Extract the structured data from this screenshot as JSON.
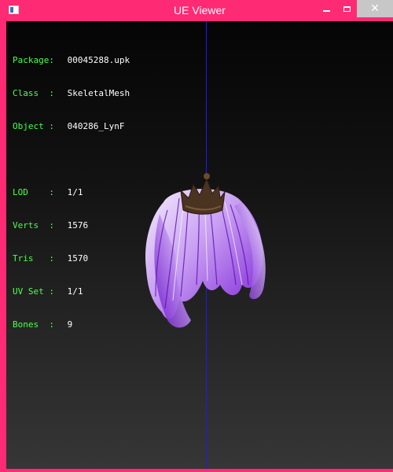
{
  "window": {
    "title": "UE Viewer",
    "close_glyph": "✕",
    "colors": {
      "frame": "#ff2a74",
      "close_button": "#c7c7c7",
      "label_text": "#4cff4c",
      "value_text": "#ffffff",
      "axis_line": "#1a1aff"
    }
  },
  "info": {
    "rows_top": [
      {
        "label": "Package:",
        "value": "00045288.upk"
      },
      {
        "label": "Class  :",
        "value": "SkeletalMesh"
      },
      {
        "label": "Object :",
        "value": "040286_LynF"
      }
    ],
    "rows_bottom": [
      {
        "label": "LOD    :",
        "value": "1/1"
      },
      {
        "label": "Verts  :",
        "value": "1576"
      },
      {
        "label": "Tris   :",
        "value": "1570"
      },
      {
        "label": "UV Set :",
        "value": "1/1"
      },
      {
        "label": "Bones  :",
        "value": "9"
      }
    ]
  }
}
